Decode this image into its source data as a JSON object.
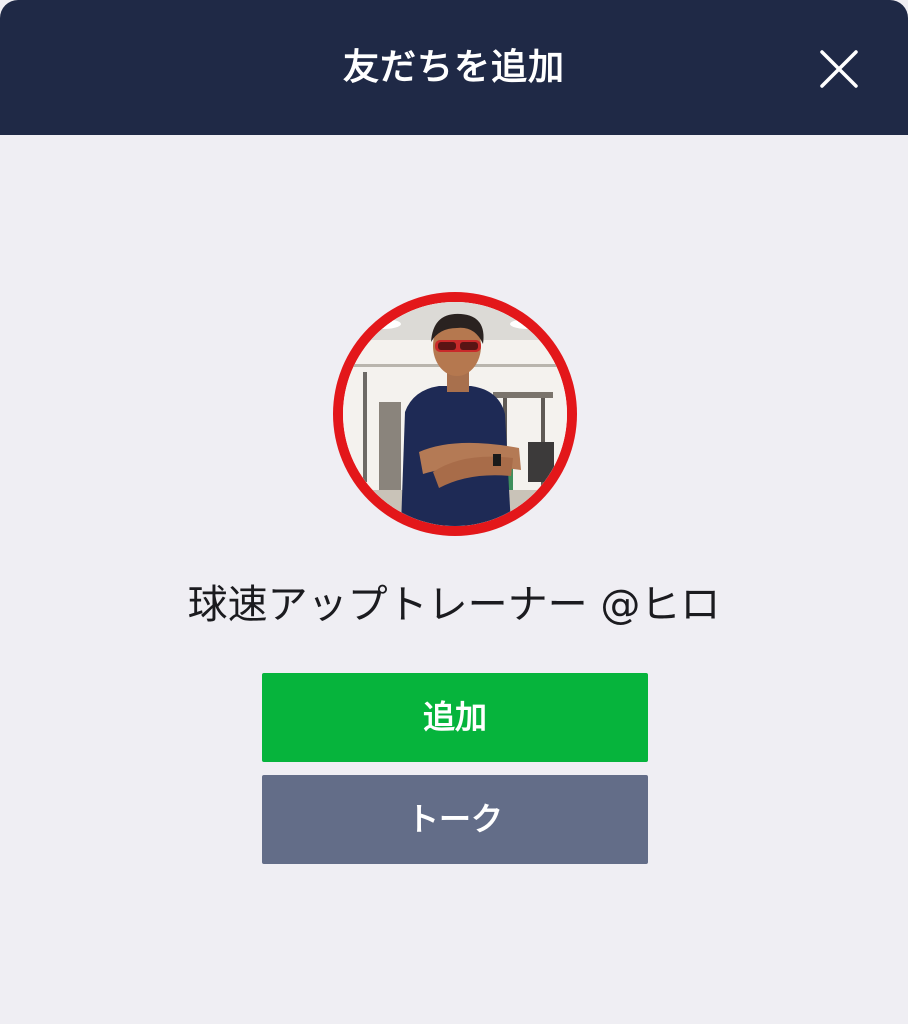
{
  "header": {
    "title": "友だちを追加",
    "close_icon": "close-icon"
  },
  "profile": {
    "avatar": "profile-photo",
    "avatar_ring_color": "#e3171a",
    "name": "球速アップトレーナー @ヒロ"
  },
  "actions": {
    "add_label": "追加",
    "add_color": "#06b43c",
    "talk_label": "トーク",
    "talk_color": "#636d88"
  },
  "colors": {
    "header_bg": "#1f2946",
    "body_bg": "#efeef3"
  }
}
